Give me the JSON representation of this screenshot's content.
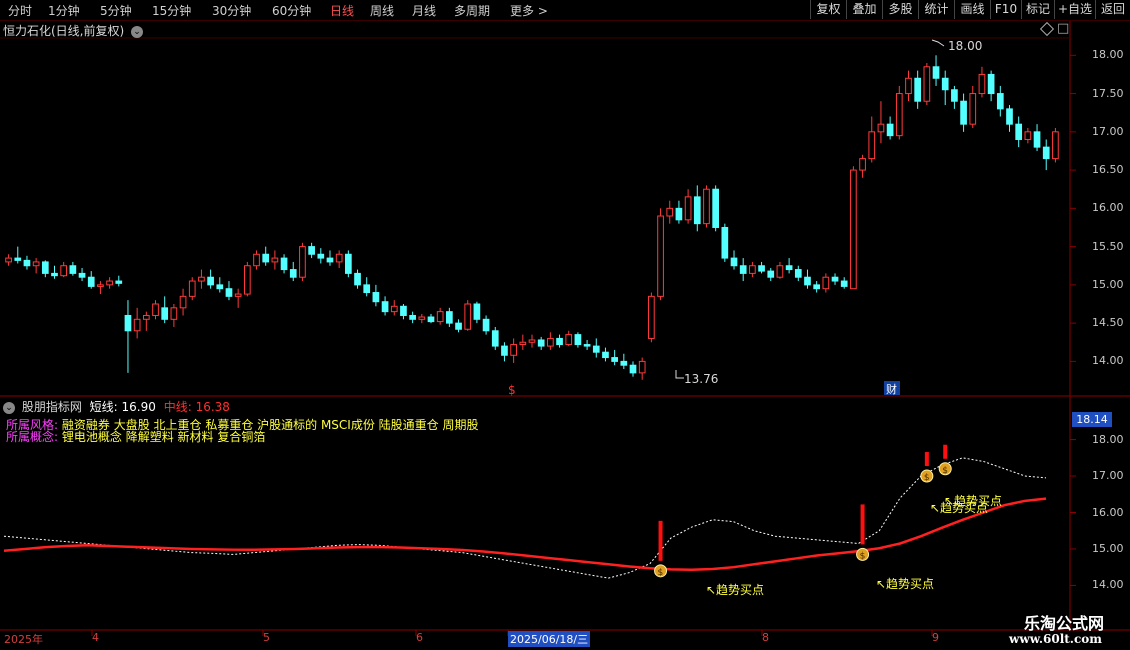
{
  "toolbar": {
    "tabs": [
      "分时",
      "1分钟",
      "5分钟",
      "15分钟",
      "30分钟",
      "60分钟",
      "日线",
      "周线",
      "月线",
      "多周期",
      "更多 >"
    ],
    "active_tab": "日线",
    "right_buttons": [
      "复权",
      "叠加",
      "多股",
      "统计",
      "画线",
      "F10",
      "标记",
      "+自选",
      "返回"
    ]
  },
  "main_chart": {
    "title": "恒力石化(日线,前复权)",
    "price_labels": [
      "18.00",
      "17.50",
      "17.00",
      "16.50",
      "16.00",
      "15.50",
      "15.00",
      "14.50",
      "14.00"
    ],
    "high_label": "18.00",
    "low_label": "13.76",
    "marker_dollar": "$",
    "marker_cai": "财"
  },
  "indicator": {
    "name": "股朋指标网",
    "short_label": "短线: 16.90",
    "mid_label": "中线: 16.38",
    "current_value": "18.14",
    "axis_labels": [
      "18.00",
      "17.00",
      "16.00",
      "15.00",
      "14.00"
    ],
    "style_key": "所属风格:",
    "style_value": "融资融券 大盘股 北上重仓 私募重仓 沪股通标的 MSCI成份 陆股通重仓 周期股",
    "concept_key": "所属概念:",
    "concept_value": "锂电池概念 降解塑料 新材料 复合铜箔",
    "signal_text": "趋势买点"
  },
  "date_axis": {
    "labels": [
      "2025年",
      "4",
      "5",
      "6",
      "2025/06/18/三",
      "8",
      "9"
    ]
  },
  "watermark": {
    "title": "乐淘公式网",
    "url": "www.60lt.com"
  },
  "colors": {
    "up": "#ff3b3b",
    "down": "#54ffff",
    "mid_line": "#ff2020",
    "short_line": "#ffffff",
    "label_yellow": "#ffff40",
    "label_magenta": "#ff40ff"
  },
  "chart_data": {
    "type": "candlestick",
    "title": "恒力石化(日线,前复权)",
    "ylim": [
      13.6,
      18.2
    ],
    "candles": [
      [
        15.3,
        15.4,
        15.25,
        15.35
      ],
      [
        15.35,
        15.5,
        15.28,
        15.32
      ],
      [
        15.32,
        15.38,
        15.2,
        15.25
      ],
      [
        15.25,
        15.35,
        15.15,
        15.3
      ],
      [
        15.3,
        15.32,
        15.1,
        15.15
      ],
      [
        15.15,
        15.25,
        15.08,
        15.12
      ],
      [
        15.12,
        15.3,
        15.1,
        15.25
      ],
      [
        15.25,
        15.3,
        15.12,
        15.15
      ],
      [
        15.15,
        15.22,
        15.05,
        15.1
      ],
      [
        15.1,
        15.18,
        14.95,
        14.98
      ],
      [
        14.98,
        15.05,
        14.88,
        15.0
      ],
      [
        15.0,
        15.1,
        14.95,
        15.05
      ],
      [
        15.05,
        15.12,
        14.98,
        15.02
      ],
      [
        14.6,
        14.8,
        13.85,
        14.4
      ],
      [
        14.4,
        14.7,
        14.3,
        14.55
      ],
      [
        14.55,
        14.65,
        14.4,
        14.6
      ],
      [
        14.6,
        14.8,
        14.55,
        14.75
      ],
      [
        14.7,
        14.85,
        14.5,
        14.55
      ],
      [
        14.55,
        14.75,
        14.45,
        14.7
      ],
      [
        14.7,
        14.95,
        14.6,
        14.85
      ],
      [
        14.85,
        15.1,
        14.8,
        15.05
      ],
      [
        15.05,
        15.2,
        14.95,
        15.1
      ],
      [
        15.1,
        15.2,
        14.95,
        15.0
      ],
      [
        15.0,
        15.1,
        14.9,
        14.95
      ],
      [
        14.95,
        15.05,
        14.8,
        14.85
      ],
      [
        14.85,
        14.95,
        14.7,
        14.88
      ],
      [
        14.88,
        15.3,
        14.85,
        15.25
      ],
      [
        15.25,
        15.45,
        15.2,
        15.4
      ],
      [
        15.4,
        15.5,
        15.25,
        15.3
      ],
      [
        15.3,
        15.45,
        15.2,
        15.35
      ],
      [
        15.35,
        15.4,
        15.15,
        15.2
      ],
      [
        15.2,
        15.3,
        15.05,
        15.1
      ],
      [
        15.1,
        15.55,
        15.05,
        15.5
      ],
      [
        15.5,
        15.55,
        15.35,
        15.4
      ],
      [
        15.4,
        15.48,
        15.28,
        15.35
      ],
      [
        15.35,
        15.45,
        15.25,
        15.3
      ],
      [
        15.3,
        15.45,
        15.22,
        15.4
      ],
      [
        15.4,
        15.45,
        15.1,
        15.15
      ],
      [
        15.15,
        15.2,
        14.95,
        15.0
      ],
      [
        15.0,
        15.1,
        14.85,
        14.9
      ],
      [
        14.9,
        15.0,
        14.72,
        14.78
      ],
      [
        14.78,
        14.85,
        14.6,
        14.65
      ],
      [
        14.65,
        14.8,
        14.6,
        14.72
      ],
      [
        14.72,
        14.75,
        14.55,
        14.6
      ],
      [
        14.6,
        14.65,
        14.5,
        14.55
      ],
      [
        14.55,
        14.62,
        14.5,
        14.58
      ],
      [
        14.58,
        14.62,
        14.5,
        14.52
      ],
      [
        14.52,
        14.7,
        14.48,
        14.65
      ],
      [
        14.65,
        14.7,
        14.45,
        14.5
      ],
      [
        14.5,
        14.55,
        14.38,
        14.42
      ],
      [
        14.42,
        14.8,
        14.4,
        14.75
      ],
      [
        14.75,
        14.78,
        14.5,
        14.55
      ],
      [
        14.55,
        14.6,
        14.35,
        14.4
      ],
      [
        14.4,
        14.45,
        14.15,
        14.2
      ],
      [
        14.2,
        14.25,
        14.0,
        14.08
      ],
      [
        14.08,
        14.3,
        13.98,
        14.22
      ],
      [
        14.22,
        14.35,
        14.15,
        14.25
      ],
      [
        14.25,
        14.35,
        14.18,
        14.28
      ],
      [
        14.28,
        14.32,
        14.15,
        14.2
      ],
      [
        14.2,
        14.38,
        14.15,
        14.3
      ],
      [
        14.3,
        14.35,
        14.18,
        14.22
      ],
      [
        14.22,
        14.4,
        14.2,
        14.35
      ],
      [
        14.35,
        14.38,
        14.18,
        14.22
      ],
      [
        14.22,
        14.28,
        14.15,
        14.2
      ],
      [
        14.2,
        14.3,
        14.05,
        14.12
      ],
      [
        14.12,
        14.18,
        14.0,
        14.05
      ],
      [
        14.05,
        14.15,
        13.95,
        14.0
      ],
      [
        14.0,
        14.1,
        13.9,
        13.95
      ],
      [
        13.95,
        14.0,
        13.8,
        13.85
      ],
      [
        13.85,
        14.05,
        13.76,
        14.0
      ],
      [
        14.3,
        14.9,
        14.25,
        14.85
      ],
      [
        14.85,
        16.0,
        14.8,
        15.9
      ],
      [
        15.9,
        16.1,
        15.8,
        16.0
      ],
      [
        16.0,
        16.1,
        15.8,
        15.85
      ],
      [
        15.85,
        16.25,
        15.8,
        16.15
      ],
      [
        16.15,
        16.3,
        15.7,
        15.8
      ],
      [
        15.8,
        16.3,
        15.75,
        16.25
      ],
      [
        16.25,
        16.3,
        15.7,
        15.75
      ],
      [
        15.75,
        15.8,
        15.3,
        15.35
      ],
      [
        15.35,
        15.45,
        15.2,
        15.25
      ],
      [
        15.25,
        15.35,
        15.05,
        15.15
      ],
      [
        15.15,
        15.3,
        15.1,
        15.25
      ],
      [
        15.25,
        15.3,
        15.15,
        15.18
      ],
      [
        15.18,
        15.22,
        15.05,
        15.1
      ],
      [
        15.1,
        15.3,
        15.08,
        15.25
      ],
      [
        15.25,
        15.35,
        15.15,
        15.2
      ],
      [
        15.2,
        15.25,
        15.05,
        15.1
      ],
      [
        15.1,
        15.2,
        14.95,
        15.0
      ],
      [
        15.0,
        15.05,
        14.9,
        14.95
      ],
      [
        14.95,
        15.15,
        14.9,
        15.1
      ],
      [
        15.1,
        15.15,
        15.0,
        15.05
      ],
      [
        15.05,
        15.1,
        14.95,
        14.98
      ],
      [
        14.95,
        16.55,
        14.95,
        16.5
      ],
      [
        16.5,
        16.7,
        16.4,
        16.65
      ],
      [
        16.65,
        17.2,
        16.6,
        17.0
      ],
      [
        17.0,
        17.4,
        16.85,
        17.1
      ],
      [
        17.1,
        17.2,
        16.9,
        16.95
      ],
      [
        16.95,
        17.6,
        16.9,
        17.5
      ],
      [
        17.5,
        17.8,
        17.4,
        17.7
      ],
      [
        17.7,
        17.8,
        17.3,
        17.4
      ],
      [
        17.4,
        17.9,
        17.35,
        17.85
      ],
      [
        17.85,
        18.0,
        17.6,
        17.7
      ],
      [
        17.7,
        17.8,
        17.35,
        17.55
      ],
      [
        17.55,
        17.6,
        17.3,
        17.4
      ],
      [
        17.4,
        17.5,
        17.0,
        17.1
      ],
      [
        17.1,
        17.6,
        17.05,
        17.5
      ],
      [
        17.5,
        17.85,
        17.45,
        17.75
      ],
      [
        17.75,
        17.8,
        17.4,
        17.5
      ],
      [
        17.5,
        17.6,
        17.2,
        17.3
      ],
      [
        17.3,
        17.35,
        17.0,
        17.1
      ],
      [
        17.1,
        17.2,
        16.8,
        16.9
      ],
      [
        16.9,
        17.05,
        16.85,
        17.0
      ],
      [
        17.0,
        17.1,
        16.75,
        16.8
      ],
      [
        16.8,
        16.9,
        16.5,
        16.65
      ],
      [
        16.65,
        17.05,
        16.6,
        17.0
      ]
    ],
    "indicator_short": [
      15.35,
      15.3,
      15.25,
      15.2,
      15.15,
      15.1,
      15.05,
      15.0,
      14.95,
      14.9,
      14.88,
      14.85,
      14.9,
      14.95,
      15.0,
      15.05,
      15.1,
      15.12,
      15.1,
      15.05,
      15.0,
      14.95,
      14.9,
      14.8,
      14.7,
      14.6,
      14.5,
      14.4,
      14.3,
      14.2,
      14.35,
      14.6,
      15.3,
      15.6,
      15.8,
      15.75,
      15.5,
      15.35,
      15.3,
      15.25,
      15.2,
      15.15,
      15.5,
      16.4,
      17.0,
      17.3,
      17.5,
      17.4,
      17.2,
      17.0,
      16.95
    ],
    "indicator_mid": [
      14.95,
      15.0,
      15.05,
      15.08,
      15.1,
      15.08,
      15.06,
      15.04,
      15.02,
      15.0,
      14.99,
      14.98,
      14.98,
      14.99,
      15.0,
      15.02,
      15.04,
      15.05,
      15.05,
      15.04,
      15.02,
      15.0,
      14.97,
      14.93,
      14.88,
      14.82,
      14.76,
      14.7,
      14.64,
      14.58,
      14.52,
      14.47,
      14.44,
      14.43,
      14.45,
      14.5,
      14.58,
      14.66,
      14.74,
      14.82,
      14.88,
      14.94,
      15.02,
      15.15,
      15.35,
      15.58,
      15.8,
      16.0,
      16.2,
      16.32,
      16.38
    ],
    "indicator_ylim": [
      13.6,
      18.4
    ],
    "buy_signals": [
      {
        "index": 71,
        "value": 14.4
      },
      {
        "index": 93,
        "value": 14.85
      },
      {
        "index": 100,
        "value": 17.0
      },
      {
        "index": 102,
        "value": 17.2
      }
    ]
  }
}
